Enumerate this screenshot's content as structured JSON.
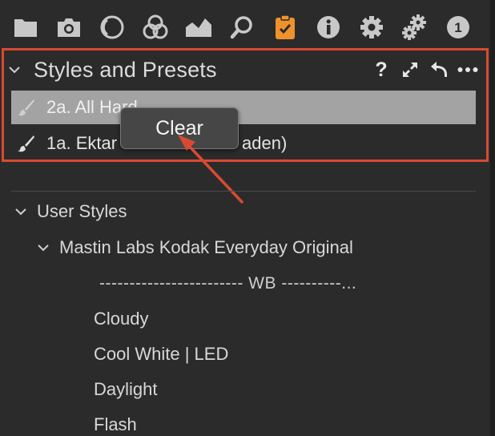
{
  "toolbar": {
    "icons": [
      {
        "name": "library-folder-icon"
      },
      {
        "name": "camera-capture-icon"
      },
      {
        "name": "lens-icon"
      },
      {
        "name": "color-circles-icon"
      },
      {
        "name": "exposure-histogram-icon"
      },
      {
        "name": "search-loupe-icon"
      },
      {
        "name": "adjustments-clipboard-icon",
        "active": true,
        "accent": "#f0922b"
      },
      {
        "name": "info-icon"
      },
      {
        "name": "settings-gear-icon"
      },
      {
        "name": "batch-gears-icon"
      },
      {
        "name": "badge-one-icon",
        "text": "1"
      }
    ]
  },
  "panel": {
    "title": "Styles and Presets",
    "help": "?",
    "presets": [
      {
        "label": "2a. All Hard",
        "selected": true
      },
      {
        "label": "1a. Ektar (faded)",
        "visible_label": "1a. Ektar",
        "suffix": "aden)"
      }
    ],
    "popup_label": "Clear",
    "highlight_color": "#d94a32"
  },
  "tree": {
    "user_styles": "User Styles",
    "group": "Mastin Labs Kodak Everyday Original",
    "separator": "------------------------ WB ----------...",
    "items": [
      "Cloudy",
      "Cool White | LED",
      "Daylight",
      "Flash"
    ]
  }
}
